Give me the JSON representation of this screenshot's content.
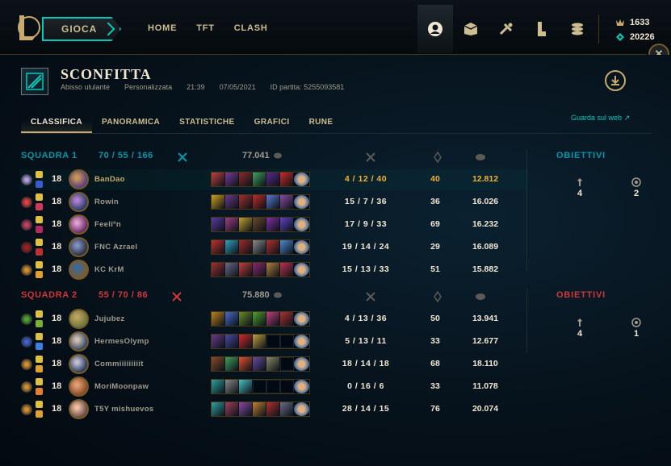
{
  "nav": {
    "play_label": "GIOCA",
    "home": "HOME",
    "tft": "TFT",
    "clash": "CLASH"
  },
  "currency": {
    "rp": "1633",
    "be": "20226"
  },
  "result": {
    "title": "SCONFITTA",
    "map": "Abisso ululante",
    "mode": "Personalizzata",
    "duration": "21:39",
    "date": "07/05/2021",
    "match_id": "ID partita: 5255093581"
  },
  "tabs": [
    "CLASSIFICA",
    "PANORAMICA",
    "STATISTICHE",
    "GRAFICI",
    "RUNE"
  ],
  "watch_web": "Guarda sul web",
  "colors": {
    "team1": "#0397ab",
    "team2": "#d13639",
    "highlight": "#f0b232",
    "gold": "#c8aa6e"
  },
  "team1": {
    "label": "SQUADRA 1",
    "kills": "70",
    "deaths": "55",
    "assists": "166",
    "gold": "77.041",
    "objectives_label": "OBIETTIVI",
    "towers": "4",
    "inhibitors": "2",
    "players": [
      {
        "level": "18",
        "name": "BanDao",
        "kda": "4 / 12 / 40",
        "cs": "40",
        "gold": "12.812",
        "me": true
      },
      {
        "level": "18",
        "name": "Rowin",
        "kda": "15 / 7 / 36",
        "cs": "36",
        "gold": "16.026"
      },
      {
        "level": "18",
        "name": "Feeliºn",
        "kda": "17 / 9 / 33",
        "cs": "69",
        "gold": "16.232"
      },
      {
        "level": "18",
        "name": "FNC Azrael",
        "kda": "19 / 14 / 24",
        "cs": "29",
        "gold": "16.089"
      },
      {
        "level": "18",
        "name": "KC KrM",
        "kda": "15 / 13 / 33",
        "cs": "51",
        "gold": "15.882"
      }
    ]
  },
  "team2": {
    "label": "SQUADRA 2",
    "kills": "55",
    "deaths": "70",
    "assists": "86",
    "gold": "75.880",
    "objectives_label": "OBIETTIVI",
    "towers": "4",
    "inhibitors": "1",
    "players": [
      {
        "level": "18",
        "name": "Jujubez",
        "kda": "4 / 13 / 36",
        "cs": "50",
        "gold": "13.941"
      },
      {
        "level": "18",
        "name": "HermesOlymp",
        "kda": "5 / 13 / 11",
        "cs": "33",
        "gold": "12.677"
      },
      {
        "level": "18",
        "name": "Commiiiiiiiiit",
        "kda": "18 / 14 / 18",
        "cs": "68",
        "gold": "18.110"
      },
      {
        "level": "18",
        "name": "MoriMoonpaw",
        "kda": "0 / 16 / 6",
        "cs": "33",
        "gold": "11.078"
      },
      {
        "level": "18",
        "name": "T5Y mishuevos",
        "kda": "28 / 14 / 15",
        "cs": "76",
        "gold": "20.074"
      }
    ]
  }
}
